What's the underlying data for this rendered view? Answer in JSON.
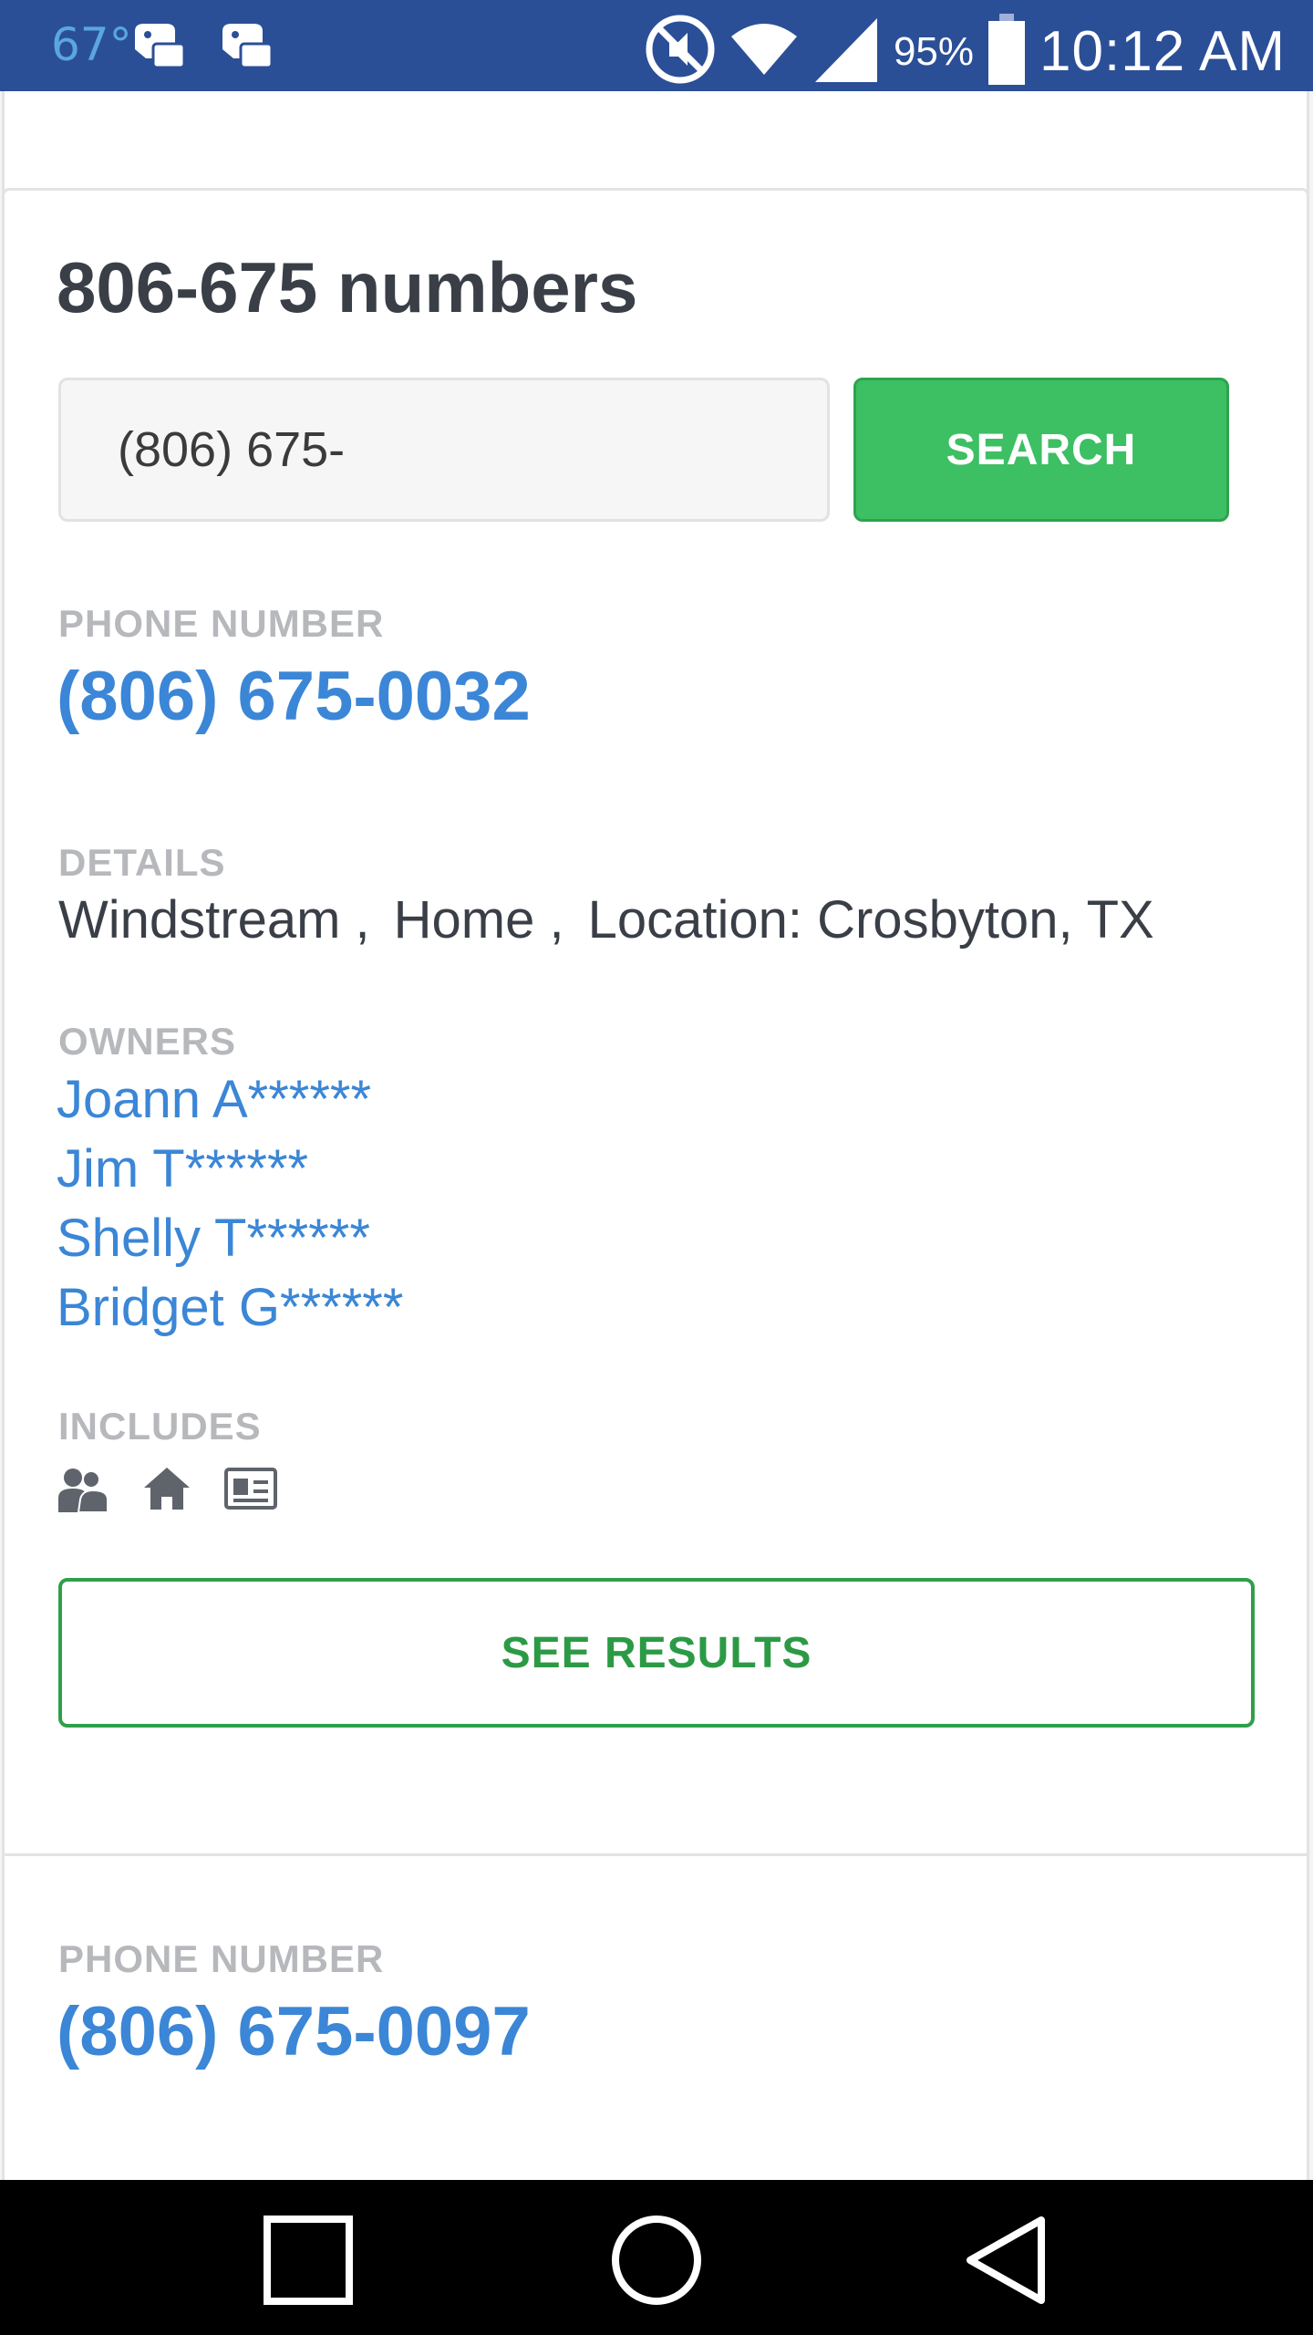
{
  "status_bar": {
    "temperature": "67°",
    "battery": "95%",
    "time": "10:12 AM",
    "icons": [
      "weather-icon",
      "game-controller-icon",
      "game-controller-icon",
      "mute-icon",
      "wifi-icon",
      "signal-icon",
      "battery-icon"
    ]
  },
  "search": {
    "title": "806-675 numbers",
    "input_value": "(806) 675-",
    "button_label": "SEARCH"
  },
  "result1": {
    "phone_label": "PHONE NUMBER",
    "phone": "(806) 675-0032",
    "details_label": "DETAILS",
    "details": [
      "Windstream ,",
      "Home ,",
      "Location: Crosbyton, TX"
    ],
    "owners_label": "OWNERS",
    "owners": [
      "Joann A******",
      "Jim T******",
      "Shelly T******",
      "Bridget G******"
    ],
    "includes_label": "INCLUDES",
    "includes_icons": [
      "people-icon",
      "home-icon",
      "id-card-icon"
    ],
    "see_results_label": "SEE RESULTS"
  },
  "result2": {
    "phone_label": "PHONE NUMBER",
    "phone": "(806) 675-0097"
  },
  "colors": {
    "status_bar": "#2b4f97",
    "accent_green": "#3dbf63",
    "link_blue": "#3b86d6",
    "label_gray": "#b6b8bc",
    "text_dark": "#3a3f47"
  }
}
